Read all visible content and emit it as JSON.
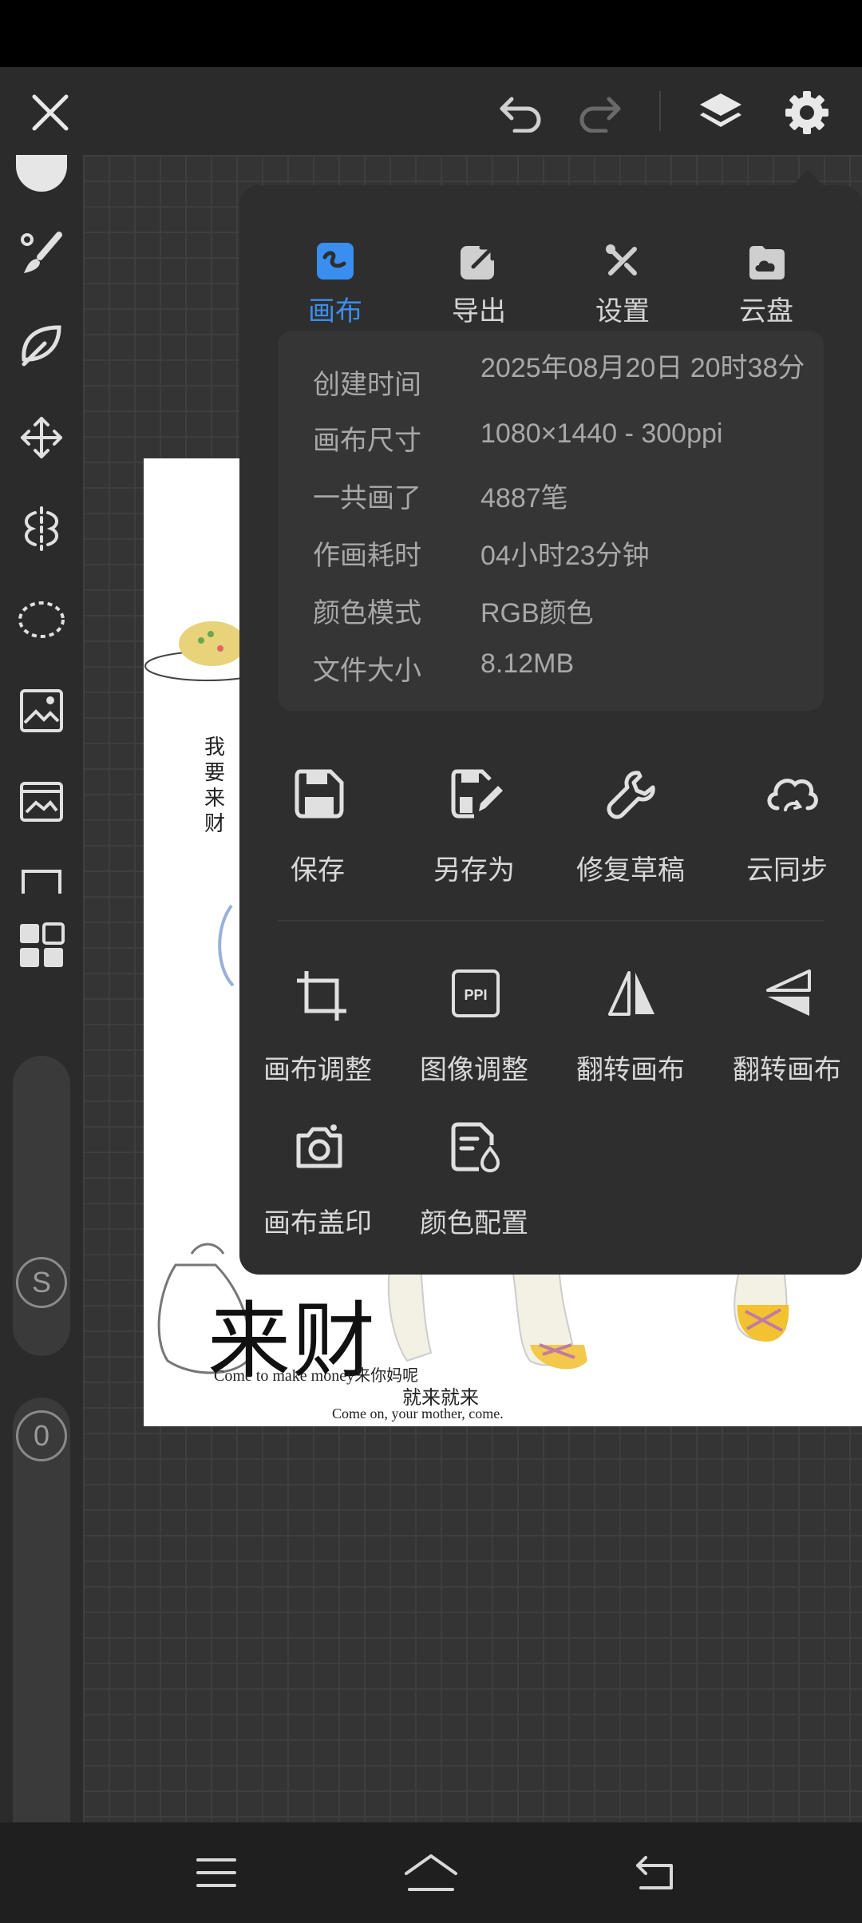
{
  "toolbar": {
    "icons": [
      "close-icon",
      "undo-icon",
      "redo-icon",
      "layers-icon",
      "settings-icon"
    ]
  },
  "sidebar": {
    "tools": [
      "color-swatch",
      "brush-icon",
      "smudge-icon",
      "move-icon",
      "symmetry-icon",
      "selection-lasso-icon",
      "image-adjust-icon",
      "image-import-icon",
      "frame-icon",
      "grid-apps-icon"
    ],
    "size_badge": "S",
    "opacity_badge": "0"
  },
  "panel": {
    "tabs": [
      {
        "label": "画布",
        "icon": "canvas-icon",
        "active": true
      },
      {
        "label": "导出",
        "icon": "export-icon",
        "active": false
      },
      {
        "label": "设置",
        "icon": "tools-icon",
        "active": false
      },
      {
        "label": "云盘",
        "icon": "cloud-drive-icon",
        "active": false
      }
    ],
    "info": [
      {
        "label": "创建时间",
        "value": "2025年08月20日 20时38分"
      },
      {
        "label": "画布尺寸",
        "value": "1080×1440 - 300ppi"
      },
      {
        "label": "一共画了",
        "value": "4887笔"
      },
      {
        "label": "作画耗时",
        "value": "04小时23分钟"
      },
      {
        "label": "颜色模式",
        "value": "RGB颜色"
      },
      {
        "label": "文件大小",
        "value": "8.12MB"
      }
    ],
    "actions_row1": [
      {
        "label": "保存",
        "icon": "save-icon"
      },
      {
        "label": "另存为",
        "icon": "save-as-icon"
      },
      {
        "label": "修复草稿",
        "icon": "wrench-icon"
      },
      {
        "label": "云同步",
        "icon": "cloud-sync-icon"
      }
    ],
    "actions_row2": [
      {
        "label": "画布调整",
        "icon": "crop-icon"
      },
      {
        "label": "图像调整",
        "icon": "ppi-icon"
      },
      {
        "label": "翻转画布",
        "icon": "flip-horizontal-icon"
      },
      {
        "label": "翻转画布",
        "icon": "flip-vertical-icon"
      }
    ],
    "actions_row3": [
      {
        "label": "画布盖印",
        "icon": "camera-icon"
      },
      {
        "label": "颜色配置",
        "icon": "color-profile-icon"
      }
    ]
  },
  "artwork": {
    "vertical_text": "我要来财",
    "big_title": "来财",
    "line1": "Come to make money来你妈呢",
    "line2": "就来就来",
    "line3": "Come on, your mother, come."
  },
  "colors": {
    "accent": "#3a8ef0",
    "panel_bg": "#2e2e2e",
    "info_bg": "#353535"
  }
}
